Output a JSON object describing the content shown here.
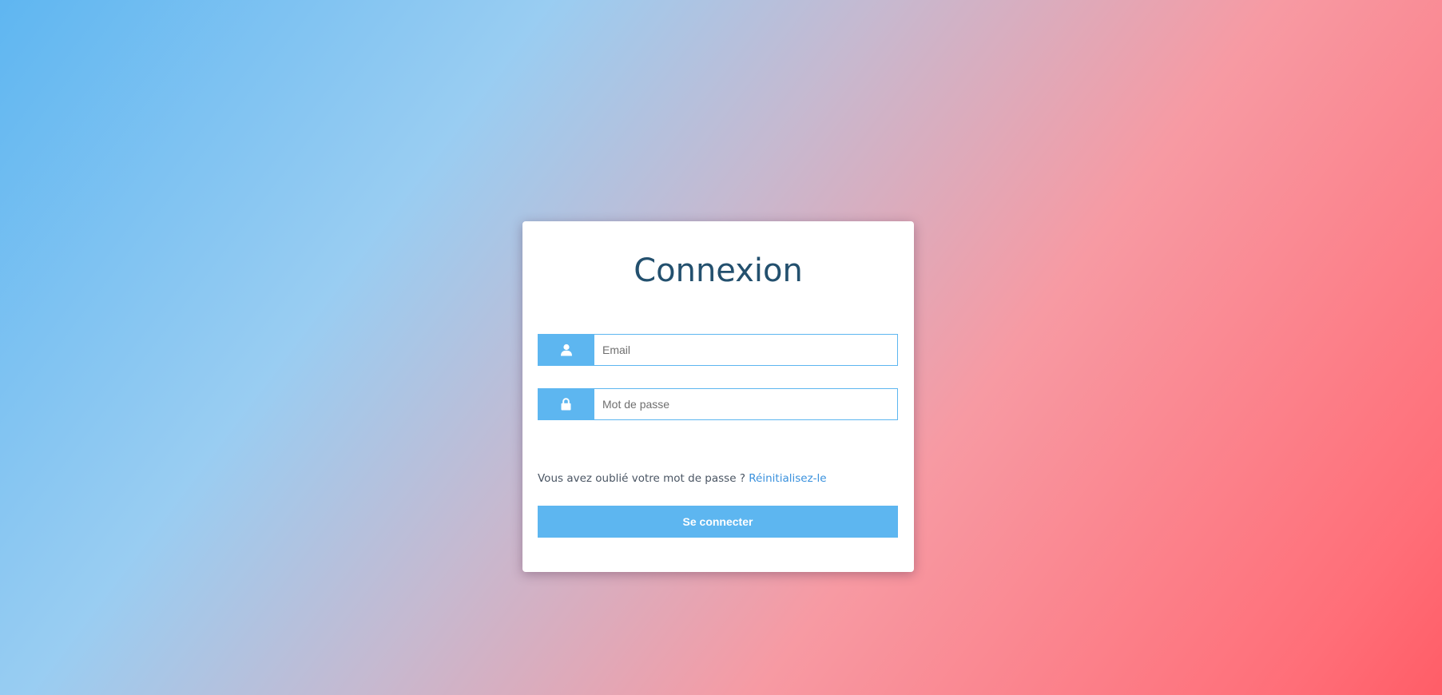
{
  "login": {
    "title": "Connexion",
    "email": {
      "placeholder": "Email",
      "value": "",
      "icon": "user-icon"
    },
    "password": {
      "placeholder": "Mot de passe",
      "value": "",
      "icon": "lock-icon"
    },
    "forgot_text": "Vous avez oublié votre mot de passe ?",
    "reset_link": "Réinitialisez-le",
    "submit_label": "Se connecter"
  },
  "colors": {
    "accent": "#5db6f0",
    "title": "#23506e",
    "link": "#3a91dd"
  }
}
